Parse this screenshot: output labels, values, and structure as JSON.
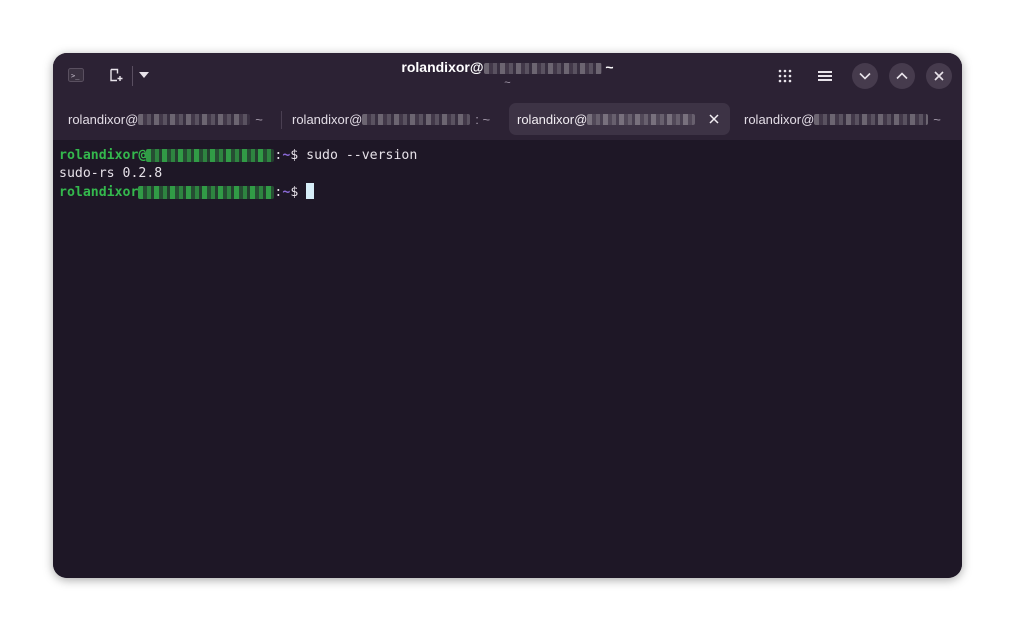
{
  "window": {
    "title": "rolandixor@",
    "title_suffix": " ~",
    "subtitle": "~"
  },
  "headerbar": {
    "left_icons": [
      "terminal-icon",
      "new-tab-icon",
      "dropdown-arrow-icon"
    ],
    "right_icons": [
      "grid-icon",
      "menu-icon",
      "minimize-icon",
      "maximize-icon",
      "close-icon"
    ]
  },
  "tabs": [
    {
      "label": "rolandixor@",
      "tail": "~",
      "active": false
    },
    {
      "label": "rolandixor@",
      "tail": ": ~",
      "active": false
    },
    {
      "label": "rolandixor@",
      "tail": "",
      "active": true
    },
    {
      "label": "rolandixor@",
      "tail": "~",
      "active": false
    }
  ],
  "terminal": {
    "lines": [
      {
        "user": "rolandixor",
        "sep": ":",
        "path": "~",
        "prompt": "$ ",
        "command": "sudo --version"
      },
      {
        "output": "sudo-rs 0.2.8"
      },
      {
        "user": "rolandixor",
        "sep": ":",
        "path": "~",
        "prompt": "$ ",
        "command": ""
      }
    ]
  },
  "colors": {
    "headerbar": "#2c2234",
    "terminal_bg": "#1e1726",
    "prompt_user": "#34b84d",
    "prompt_path": "#8b6ad8",
    "cursor": "#d7eef8"
  }
}
